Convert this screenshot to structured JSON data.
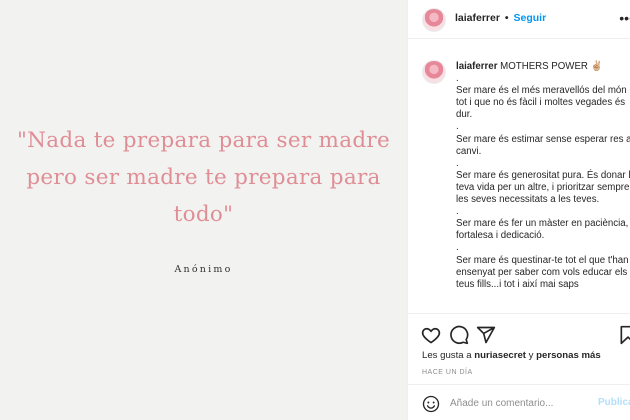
{
  "post": {
    "quote": "\"Nada te prepara para ser madre pero ser madre te prepara para todo\"",
    "author": "Anónimo"
  },
  "header": {
    "username": "laiaferrer",
    "separator": "•",
    "follow_label": "Seguir",
    "more_icon": "more-icon"
  },
  "caption": {
    "username": "laiaferrer",
    "text": " MOTHERS POWER ✌🏼\n.\nSer mare és el més meravellós del món tot i que no és fàcil i moltes vegades és dur.\n.\nSer mare és estimar sense esperar res a canvi.\n.\nSer mare és generositat pura. És donar la teva vida per un altre, i prioritzar sempre les seves necessitats a les teves.\n.\nSer mare és fer un màster en paciència, fortalesa i dedicació.\n.\nSer mare és questinar-te tot el que t'han ensenyat per saber com vols educar els teus fills...i tot i així mai saps"
  },
  "actions": {
    "icons": [
      "heart-icon",
      "comment-icon",
      "share-icon",
      "bookmark-icon"
    ],
    "likes_prefix": "Les gusta a ",
    "likes_user": "nuriasecret",
    "likes_middle": " y ",
    "likes_others": "personas más",
    "time": "HACE UN DÍA"
  },
  "comment": {
    "placeholder": "Añade un comentario...",
    "publish_label": "Publicar",
    "emoji_icon": "smiley-icon"
  },
  "colors": {
    "quote": "#e08e96",
    "follow": "#0095f6",
    "publish_disabled": "#b2dffc",
    "image_bg": "#f2f2f0"
  }
}
